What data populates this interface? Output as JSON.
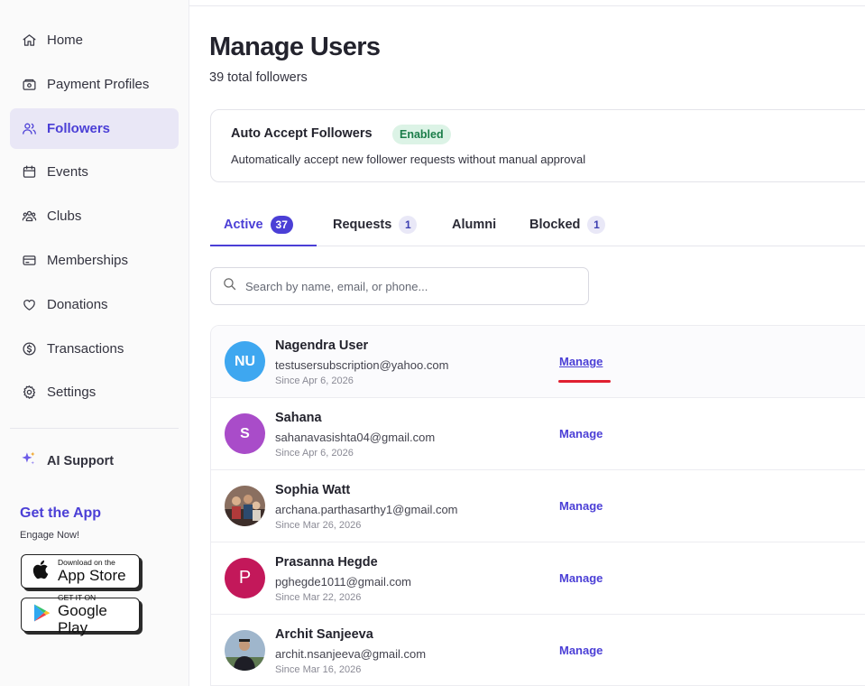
{
  "sidebar": {
    "items": [
      {
        "label": "Home",
        "icon": "home-icon"
      },
      {
        "label": "Payment Profiles",
        "icon": "wallet-icon"
      },
      {
        "label": "Followers",
        "icon": "users-icon",
        "active": true
      },
      {
        "label": "Events",
        "icon": "calendar-icon"
      },
      {
        "label": "Clubs",
        "icon": "group-icon"
      },
      {
        "label": "Memberships",
        "icon": "card-icon"
      },
      {
        "label": "Donations",
        "icon": "heart-icon"
      },
      {
        "label": "Transactions",
        "icon": "dollar-icon"
      },
      {
        "label": "Settings",
        "icon": "gear-icon"
      }
    ],
    "ai_support": "AI Support",
    "get_app": "Get the App",
    "engage": "Engage Now!",
    "app_store": {
      "small": "Download on the",
      "big": "App Store"
    },
    "google_play": {
      "small": "GET IT ON",
      "big": "Google Play"
    }
  },
  "header": {
    "title": "Manage Users",
    "subtitle": "39 total followers"
  },
  "auto_accept": {
    "title": "Auto Accept Followers",
    "badge": "Enabled",
    "description": "Automatically accept new follower requests without manual approval"
  },
  "tabs": [
    {
      "label": "Active",
      "count": "37"
    },
    {
      "label": "Requests",
      "count": "1"
    },
    {
      "label": "Alumni",
      "count": ""
    },
    {
      "label": "Blocked",
      "count": "1"
    }
  ],
  "search": {
    "placeholder": "Search by name, email, or phone..."
  },
  "users": [
    {
      "name": "Nagendra User",
      "email": "testusersubscription@yahoo.com",
      "since": "Since Apr 6, 2026",
      "initials": "NU",
      "avatar_color": "#3ea7f0",
      "action": "Manage"
    },
    {
      "name": "Sahana",
      "email": "sahanavasishta04@gmail.com",
      "since": "Since Apr 6, 2026",
      "initials": "S",
      "avatar_color": "#a94cc9",
      "action": "Manage"
    },
    {
      "name": "Sophia Watt",
      "email": "archana.parthasarthy1@gmail.com",
      "since": "Since Mar 26, 2026",
      "initials": "",
      "avatar_color": "#7a5a4a",
      "action": "Manage"
    },
    {
      "name": "Prasanna Hegde",
      "email": "pghegde1011@gmail.com",
      "since": "Since Mar 22, 2026",
      "initials": "P",
      "avatar_color": "#c3185a",
      "action": "Manage"
    },
    {
      "name": "Archit Sanjeeva",
      "email": "archit.nsanjeeva@gmail.com",
      "since": "Since Mar 16, 2026",
      "initials": "",
      "avatar_color": "#6e8aa8",
      "action": "Manage"
    }
  ],
  "colors": {
    "accent": "#4b3fd6",
    "annotation_red": "#e02030"
  }
}
